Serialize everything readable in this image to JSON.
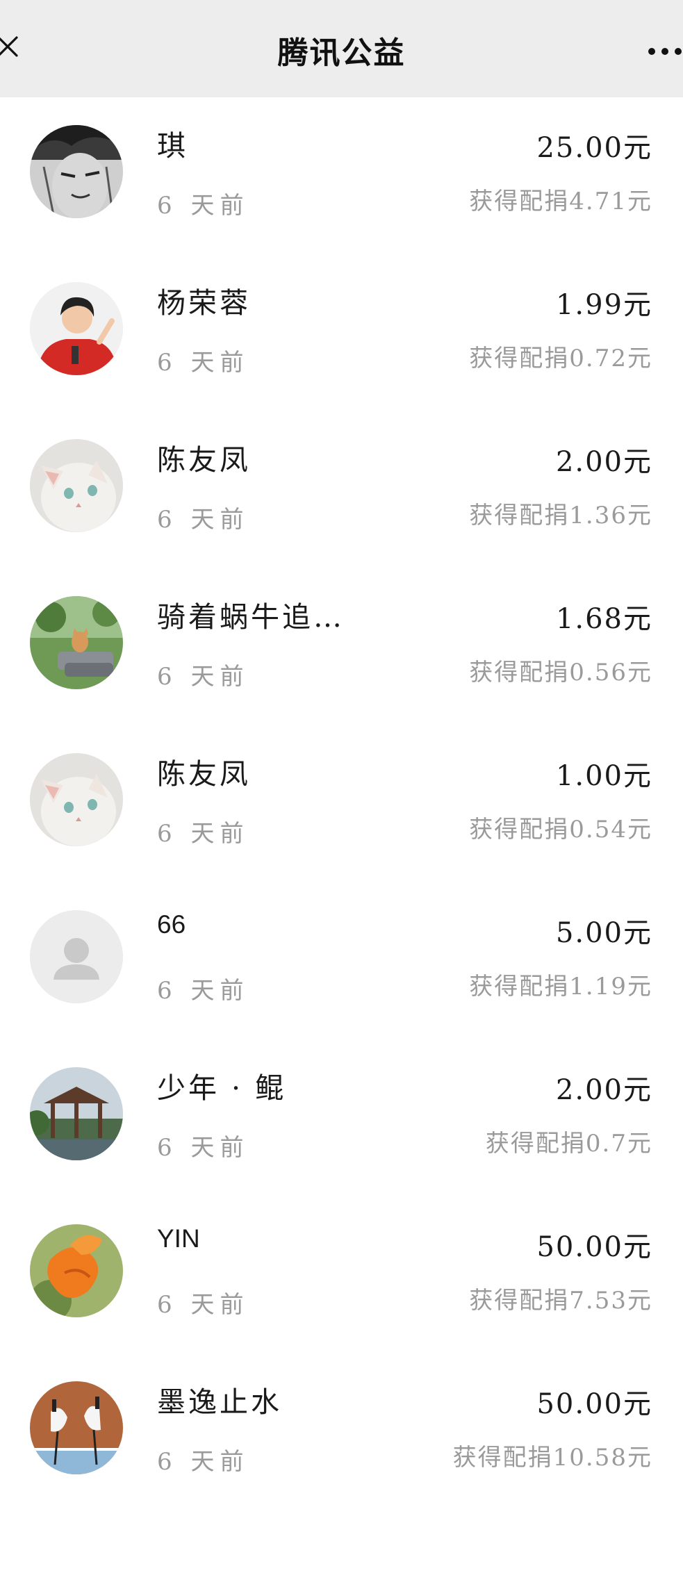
{
  "header": {
    "title": "腾讯公益",
    "close_icon": "close-icon",
    "more_icon": "more-icon"
  },
  "donations": [
    {
      "name": "琪",
      "time": "6 天前",
      "amount": "25.00元",
      "match": "获得配捐4.71元",
      "avatar": "comic-portrait"
    },
    {
      "name": "杨荣蓉",
      "time": "6 天前",
      "amount": "1.99元",
      "match": "获得配捐0.72元",
      "avatar": "woman-red-shirt"
    },
    {
      "name": "陈友凤",
      "time": "6 天前",
      "amount": "2.00元",
      "match": "获得配捐1.36元",
      "avatar": "white-cat"
    },
    {
      "name": "骑着蜗牛追…",
      "time": "6 天前",
      "amount": "1.68元",
      "match": "获得配捐0.56元",
      "avatar": "cat-garden"
    },
    {
      "name": "陈友凤",
      "time": "6 天前",
      "amount": "1.00元",
      "match": "获得配捐0.54元",
      "avatar": "white-cat"
    },
    {
      "name": "66",
      "time": "6 天前",
      "amount": "5.00元",
      "match": "获得配捐1.19元",
      "avatar": "default-user"
    },
    {
      "name": "少年 · 鲲",
      "time": "6 天前",
      "amount": "2.00元",
      "match": "获得配捐0.7元",
      "avatar": "pavilion"
    },
    {
      "name": "YIN",
      "time": "6 天前",
      "amount": "50.00元",
      "match": "获得配捐7.53元",
      "avatar": "orange-flower"
    },
    {
      "name": "墨逸止水",
      "time": "6 天前",
      "amount": "50.00元",
      "match": "获得配捐10.58元",
      "avatar": "cranes"
    }
  ]
}
